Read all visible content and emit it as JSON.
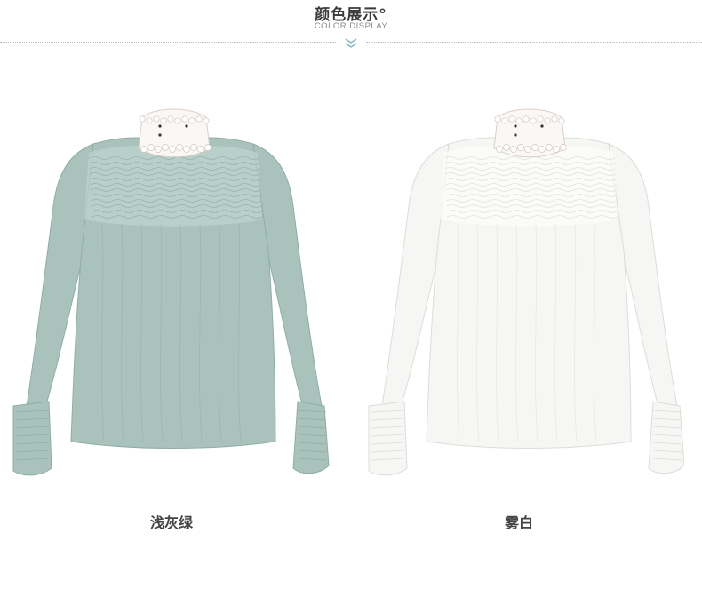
{
  "header": {
    "title": "颜色展示°",
    "subtitle": "COLOR DISPLAY"
  },
  "products": [
    {
      "caption": "浅灰绿",
      "color": "#a9c3bc",
      "shade": "#8fada5",
      "highlight": "#c7dad5"
    },
    {
      "caption": "雾白",
      "color": "#f6f6f4",
      "shade": "#dcdcd8",
      "highlight": "#ffffff"
    }
  ]
}
